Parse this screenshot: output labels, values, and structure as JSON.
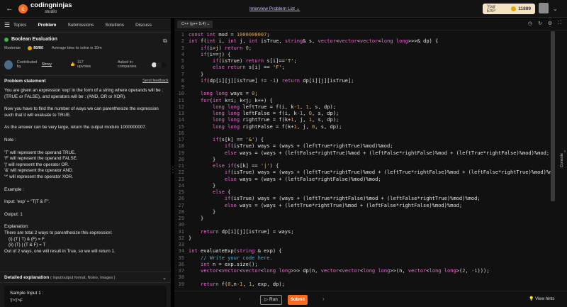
{
  "header": {
    "logo_line1": "codingninjas",
    "logo_line2": "studio",
    "problem_list": "Interview Problem List",
    "exp_label": "Your EXP",
    "exp_value": "11889"
  },
  "tabs": [
    "Topics",
    "Problem",
    "Submissions",
    "Solutions",
    "Discuss"
  ],
  "problem": {
    "title": "Boolean Evaluation",
    "difficulty": "Moderate",
    "score": "80/80",
    "avg_time": "Average time to solve is 10m",
    "contributed_by": "Contributed by",
    "author": "Shrey",
    "upvotes": "117 upvotes",
    "asked_in": "Asked in companies"
  },
  "statement_label": "Problem statement",
  "send_feedback": "Send feedback",
  "description": [
    "You are given an expression 'exp' in the form of a string where operands will be : (TRUE or FALSE), and operators will be : (AND, OR or XOR).",
    "",
    "Now you have to find the number of ways we can parenthesize the expression such that it will evaluate to TRUE.",
    "",
    "As the answer can be very large, return the output modulo 1000000007.",
    "",
    "Note :",
    "",
    "'T' will represent the operand TRUE.",
    "'F' will represent the operand FALSE.",
    "'|' will represent the operator OR.",
    "'&' will represent the operator AND.",
    "'^' will represent the operator XOR.",
    "",
    "Example :",
    "",
    "Input: 'exp’ = \"T|T & F\".",
    "",
    "Output: 1",
    "",
    "Explanation:",
    "There are total 2  ways to parenthesize this expression:",
    "    (i) (T | T) & (F) = F",
    "    (ii) (T) | (T & F) = T",
    "Out of 2 ways, one will result in True, so we will return 1."
  ],
  "detailed": {
    "title": "Detailed explanation",
    "sub": "( Input/output format, Notes, Images )"
  },
  "sample": {
    "label": "Sample Input 1 :",
    "value": "T^T^F"
  },
  "editor": {
    "language": "C++ (g++ 5.4)",
    "console": "Console",
    "run": "Run",
    "submit": "Submit",
    "hints": "View hints"
  },
  "line_numbers": [
    "1",
    "2",
    "3",
    "4",
    "5",
    "6",
    "7",
    "8",
    "9",
    "10",
    "11",
    "12",
    "13",
    "14",
    "15",
    "16",
    "17",
    "18",
    "19",
    "20",
    "21",
    "22",
    "23",
    "24",
    "25",
    "26",
    "27",
    "28",
    "29",
    "30",
    "31",
    "32",
    "33",
    "34",
    "35",
    "36",
    "37",
    "38",
    "39"
  ]
}
